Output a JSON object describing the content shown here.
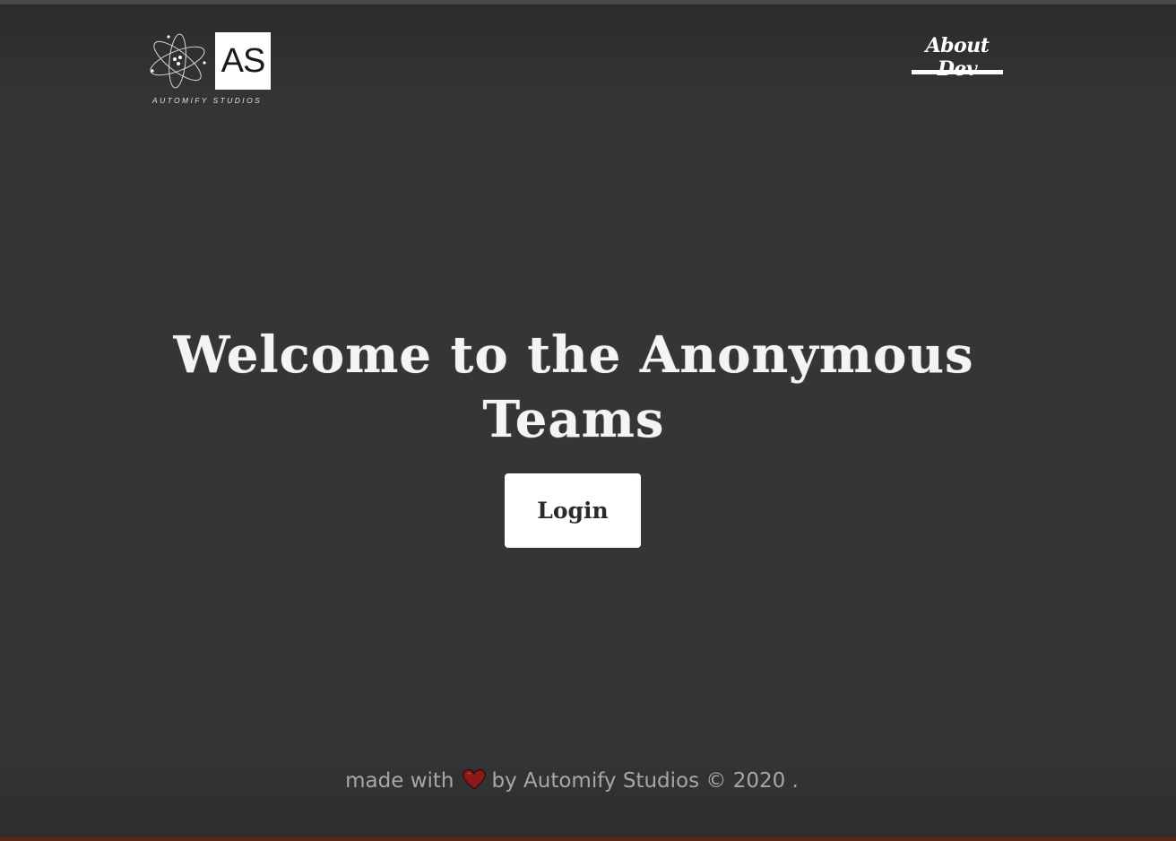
{
  "header": {
    "logo": {
      "monogram": "AS",
      "studio_name": "AUTOMIFY STUDIOS",
      "icon": "atom-icon"
    },
    "nav": {
      "about_label": "About Dev"
    }
  },
  "hero": {
    "title": "Welcome to the Anonymous Teams",
    "login_label": "Login"
  },
  "footer": {
    "made_with": "made with",
    "heart_icon": "heart-icon",
    "by_text": "by Automify Studios © 2020 ."
  },
  "colors": {
    "background": "#353535",
    "text_primary": "#ffffff",
    "footer_text": "#a7a7a7",
    "heart": "#8b1a1a"
  }
}
